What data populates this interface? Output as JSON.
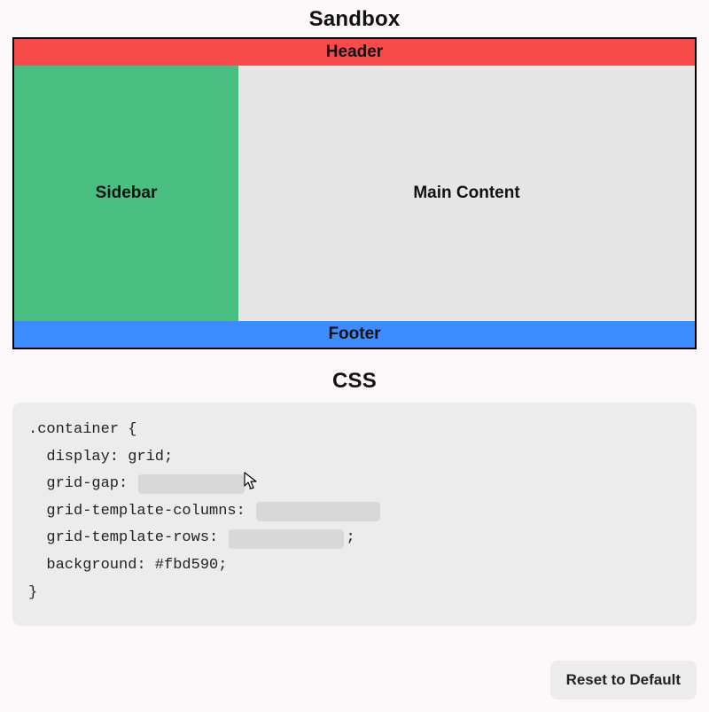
{
  "sandbox": {
    "title": "Sandbox",
    "regions": {
      "header": "Header",
      "sidebar": "Sidebar",
      "main": "Main Content",
      "footer": "Footer"
    }
  },
  "css": {
    "title": "CSS",
    "selector_open": ".container {",
    "prop_display": "display: grid;",
    "prop_gap_label": "grid-gap: ",
    "prop_gap_value": "",
    "semi": ";",
    "prop_cols_label": "grid-template-columns: ",
    "prop_cols_value": "",
    "prop_rows_label": "grid-template-rows: ",
    "prop_rows_value": "",
    "prop_bg": "background: #fbd590;",
    "selector_close": "}"
  },
  "buttons": {
    "reset": "Reset to Default"
  }
}
